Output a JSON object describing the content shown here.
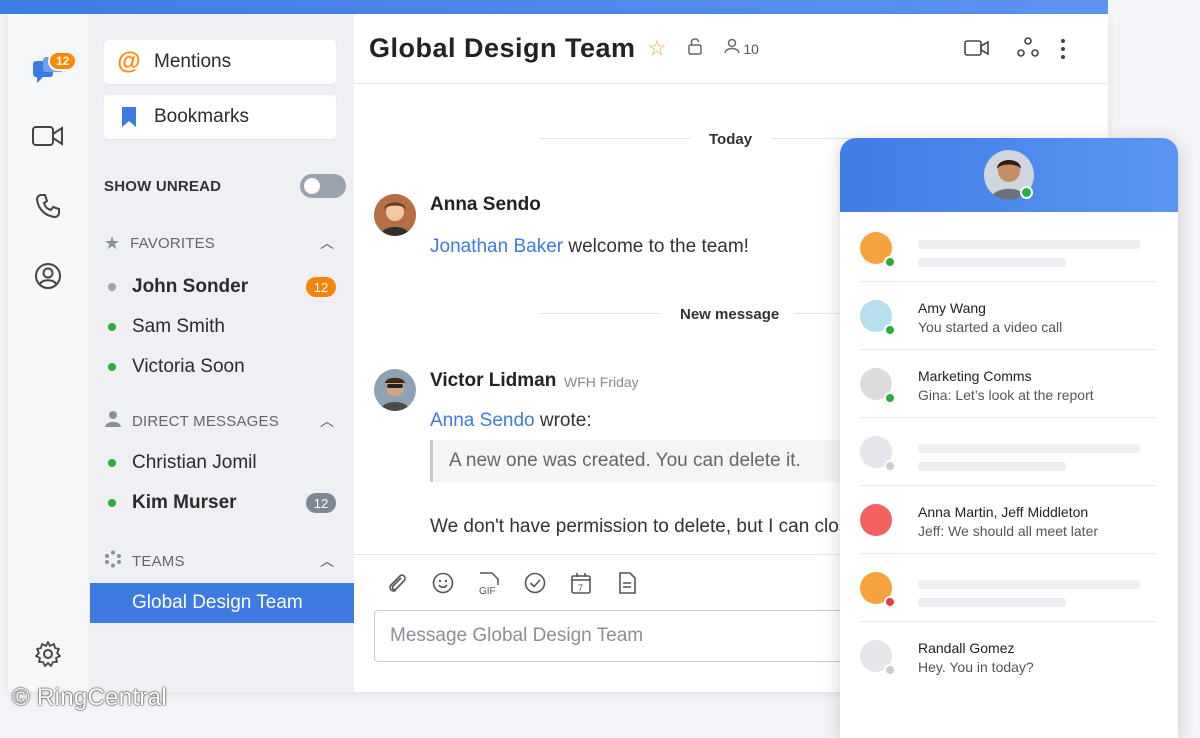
{
  "rail": {
    "badge": "12"
  },
  "sidebar": {
    "mentions": "Mentions",
    "bookmarks": "Bookmarks",
    "show_unread": "SHOW UNREAD",
    "favorites": {
      "title": "FAVORITES",
      "items": [
        {
          "name": "John Sonder",
          "bold": true,
          "status": "#a0a4ab",
          "count": "12",
          "count_color": "#f5850a"
        },
        {
          "name": "Sam Smith",
          "status": "#2eaa3a"
        },
        {
          "name": "Victoria Soon",
          "status": "#2eaa3a"
        }
      ]
    },
    "direct_messages": {
      "title": "DIRECT MESSAGES",
      "items": [
        {
          "name": "Christian Jomil",
          "status": "#2eaa3a"
        },
        {
          "name": "Kim Murser",
          "bold": true,
          "status": "#2eaa3a",
          "count": "12",
          "count_color": "#7d8795"
        }
      ]
    },
    "teams": {
      "title": "TEAMS",
      "selected": "Global Design Team"
    }
  },
  "header": {
    "title": "Global Design Team",
    "member_count": "10"
  },
  "chat": {
    "day_divider": "Today",
    "messages": [
      {
        "sender": "Anna Sendo",
        "mention": "Jonathan Baker",
        "text": " welcome to the team!"
      },
      {
        "sender": "Victor Lidman",
        "meta": "WFH Friday",
        "mention": "Anna Sendo",
        "text": " wrote:",
        "quote": "A new one was created. You can delete it.",
        "body": "We don't have permission to delete, but I can close i"
      }
    ],
    "new_divider": "New message"
  },
  "composer": {
    "placeholder": "Message Global Design Team"
  },
  "phone": {
    "rows": [
      {
        "placeholder": true,
        "avatar": "#f7a23e",
        "status": "#2eaa3a"
      },
      {
        "name": "Amy Wang",
        "sub": "You started a video call",
        "avatar": "#b8def0",
        "status": "#2eaa3a"
      },
      {
        "name": "Marketing Comms",
        "sub": "Gina: Let’s look at the report",
        "avatar": "#dcdcdc",
        "status": "#2eaa3a"
      },
      {
        "placeholder": true,
        "avatar": "#e4e6ea",
        "status": "#c9ccd1"
      },
      {
        "name": "Anna Martin, Jeff Middleton",
        "sub": "Jeff: We should all meet later",
        "avatar": "#f26060",
        "status": null
      },
      {
        "placeholder": true,
        "avatar": "#f7a23e",
        "status": "#e04040"
      },
      {
        "name": "Randall Gomez",
        "sub": "Hey. You in today?",
        "avatar": "#e4e6ea",
        "status": "#c9ccd1"
      }
    ]
  },
  "watermark": "© RingCentral",
  "colors": {
    "accent": "#3d7be3",
    "online": "#2eaa3a",
    "badge": "#ff8800"
  }
}
